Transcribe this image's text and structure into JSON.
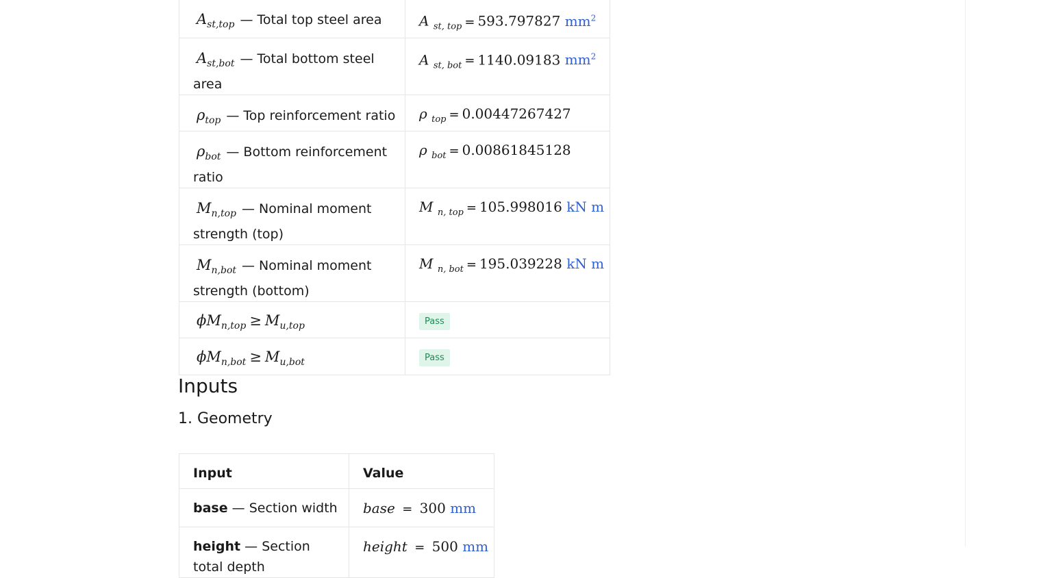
{
  "results": {
    "rows": [
      {
        "sym": "A",
        "sub": "st,top",
        "desc": "— Total top steel area",
        "val_sym": "A",
        "val_sub": "st, top",
        "value": "593.797827",
        "unit": "mm",
        "unit_sup": "2"
      },
      {
        "sym": "A",
        "sub": "st,bot",
        "desc": "— Total bottom steel area",
        "val_sym": "A",
        "val_sub": "st, bot",
        "value": "1140.09183",
        "unit": "mm",
        "unit_sup": "2"
      },
      {
        "sym": "ρ",
        "sub": "top",
        "desc": "— Top reinforcement ratio",
        "val_sym": "ρ",
        "val_sub": "top",
        "value": "0.00447267427"
      },
      {
        "sym": "ρ",
        "sub": "bot",
        "desc": "— Bottom reinforcement ratio",
        "val_sym": "ρ",
        "val_sub": "bot",
        "value": "0.00861845128"
      },
      {
        "sym": "M",
        "sub": "n,top",
        "desc": "— Nominal moment strength (top)",
        "val_sym": "M",
        "val_sub": "n, top",
        "value": "105.998016",
        "unit": "kN m"
      },
      {
        "sym": "M",
        "sub": "n,bot",
        "desc": "— Nominal moment strength (bottom)",
        "val_sym": "M",
        "val_sub": "n, bot",
        "value": "195.039228",
        "unit": "kN m"
      }
    ],
    "checks": [
      {
        "lhs": "ϕM",
        "lhs_sub": "n,top",
        "op": "≥",
        "rhs": "M",
        "rhs_sub": "u,top",
        "status": "Pass"
      },
      {
        "lhs": "ϕM",
        "lhs_sub": "n,bot",
        "op": "≥",
        "rhs": "M",
        "rhs_sub": "u,bot",
        "status": "Pass"
      }
    ],
    "eq": "="
  },
  "inputs": {
    "heading": "Inputs",
    "subheading": "1. Geometry",
    "header": {
      "input": "Input",
      "value": "Value"
    },
    "rows": [
      {
        "name": "base",
        "desc": " — Section width",
        "sym": "base",
        "value": "300",
        "unit": "mm"
      },
      {
        "name": "height",
        "desc": " — Section total depth",
        "sym": "height",
        "value": "500",
        "unit": "mm"
      }
    ]
  },
  "colors": {
    "unit": "#2f5fd1",
    "pass_bg": "#dff5ea",
    "pass_text": "#1f8a55"
  }
}
